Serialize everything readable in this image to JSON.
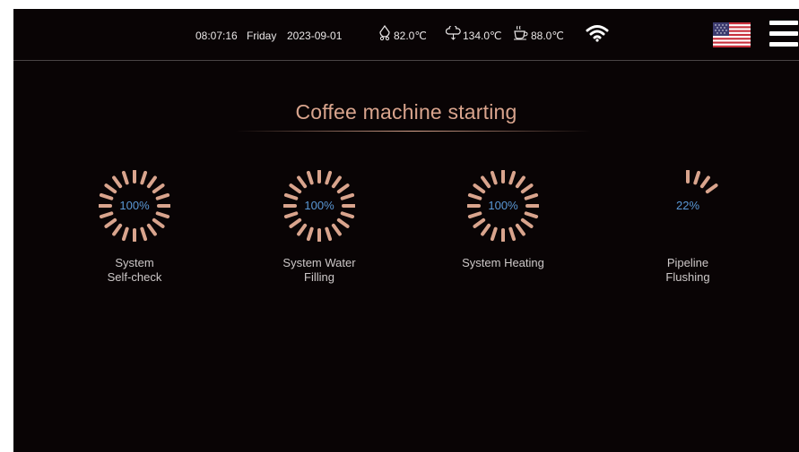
{
  "status_bar": {
    "time": "08:07:16",
    "day": "Friday",
    "date": "2023-09-01",
    "boiler_temp": "82.0℃",
    "steam_temp": "134.0℃",
    "brew_temp": "88.0℃",
    "icons": [
      "water-drop-temp-icon",
      "steam-cloud-icon",
      "coffee-cup-icon",
      "wifi-icon",
      "us-flag-icon",
      "hamburger-menu-icon"
    ]
  },
  "title": "Coffee machine starting",
  "steps": [
    {
      "value": "100%",
      "progress": 1.0,
      "label_line1": "System",
      "label_line2": "Self-check"
    },
    {
      "value": "100%",
      "progress": 1.0,
      "label_line1": "System Water",
      "label_line2": "Filling"
    },
    {
      "value": "100%",
      "progress": 1.0,
      "label_line1": "System Heating",
      "label_line2": ""
    },
    {
      "value": "22%",
      "progress": 0.22,
      "label_line1": "Pipeline",
      "label_line2": "Flushing"
    }
  ],
  "colors": {
    "background": "#090405",
    "accent": "#d9a48d",
    "value_text": "#5a98d6",
    "label_text": "#cdc8c8"
  }
}
